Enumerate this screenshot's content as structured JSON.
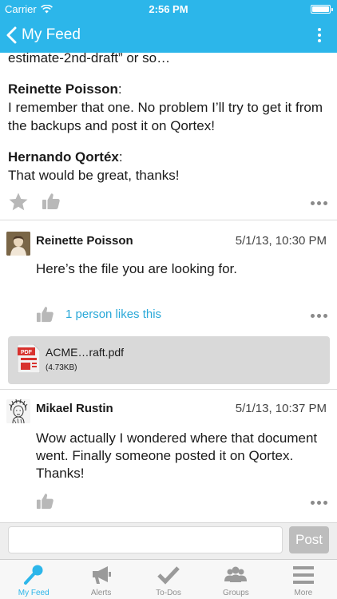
{
  "status_bar": {
    "carrier": "Carrier",
    "time": "2:56 PM"
  },
  "nav": {
    "back_label": "My Feed"
  },
  "thread": {
    "intro_text": "estimate-2nd-draft” or so…",
    "quotes": [
      {
        "author": "Reinette Poisson",
        "separator": ":",
        "text": "I remember that one. No problem I’ll try to get it from the backups and post it on Qortex!"
      },
      {
        "author": "Hernando Qortéx",
        "separator": ":",
        "text": "That would be great, thanks!"
      }
    ]
  },
  "comments": [
    {
      "author": "Reinette Poisson",
      "time": "5/1/13, 10:30 PM",
      "body": "Here’s the file you are looking for.",
      "likes_text": "1 person likes this",
      "attachment": {
        "name": "ACME…raft.pdf",
        "size": "(4.73KB)",
        "badge": "PDF"
      }
    },
    {
      "author": "Mikael Rustin",
      "time": "5/1/13, 10:37 PM",
      "body": "Wow actually I wondered where that document went. Finally someone posted it on Qortex. Thanks!"
    }
  ],
  "composer": {
    "placeholder": "",
    "post_label": "Post"
  },
  "tabs": [
    {
      "label": "My Feed",
      "icon": "search-icon",
      "active": true
    },
    {
      "label": "Alerts",
      "icon": "megaphone-icon",
      "active": false
    },
    {
      "label": "To-Dos",
      "icon": "checkmark-icon",
      "active": false
    },
    {
      "label": "Groups",
      "icon": "group-icon",
      "active": false
    },
    {
      "label": "More",
      "icon": "menu-icon",
      "active": false
    }
  ],
  "colors": {
    "accent": "#2cb6ea",
    "link": "#2aa8d8",
    "icon_gray": "#b5b5b5"
  }
}
